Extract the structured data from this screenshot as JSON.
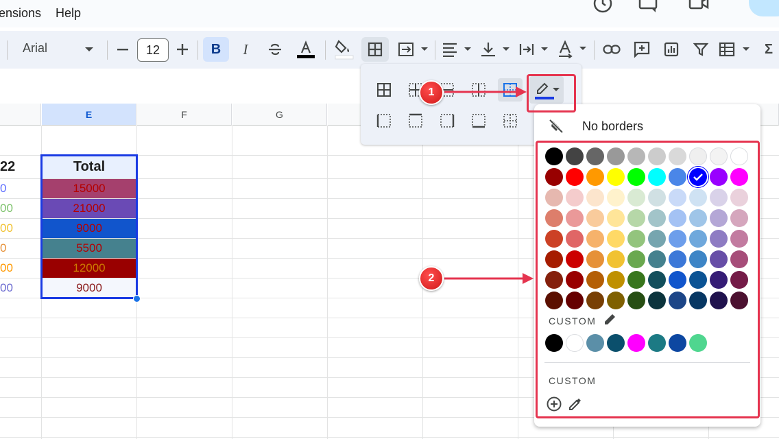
{
  "menubar": {
    "items": [
      "ensions",
      "Help"
    ]
  },
  "toolbar": {
    "font_name": "Arial",
    "font_size": "12",
    "bold_label": "B",
    "italic_label": "I",
    "text_color_underline": "#000000",
    "sum_label": "Σ"
  },
  "grid": {
    "columns": [
      {
        "label": "E",
        "selected": true
      },
      {
        "label": "F",
        "selected": false
      },
      {
        "label": "G",
        "selected": false
      }
    ],
    "header_row": {
      "partial_left": "22",
      "total_label": "Total"
    },
    "rows": [
      {
        "left": "0",
        "left_color": "#5b6cff",
        "value": "15000",
        "bg": "#a5406d",
        "fg": "#b40000"
      },
      {
        "left": "00",
        "left_color": "#7cc26b",
        "value": "21000",
        "bg": "#6a4ab5",
        "fg": "#b40000"
      },
      {
        "left": "00",
        "left_color": "#f1c232",
        "value": "9000",
        "bg": "#1155cc",
        "fg": "#b40000"
      },
      {
        "left": "0",
        "left_color": "#e69138",
        "value": "5500",
        "bg": "#45818e",
        "fg": "#b40000"
      },
      {
        "left": "00",
        "left_color": "#ff9900",
        "value": "12000",
        "bg": "#990000",
        "fg": "#cc7a00"
      },
      {
        "left": "00",
        "left_color": "#6d6dd1",
        "value": "9000",
        "bg": "#f4f7fd",
        "fg": "#8b1c1c"
      }
    ]
  },
  "borders_menu": {
    "line_color_indicator": "#1a3be3"
  },
  "color_popup": {
    "no_borders_label": "No borders",
    "custom_label_1": "CUSTOM",
    "custom_label_2": "CUSTOM",
    "selected_color": "#0000ff",
    "palette_rows": [
      [
        "#000000",
        "#434343",
        "#666666",
        "#999999",
        "#b7b7b7",
        "#cccccc",
        "#d9d9d9",
        "#efefef",
        "#f3f3f3",
        "#ffffff"
      ],
      [
        "#980000",
        "#ff0000",
        "#ff9900",
        "#ffff00",
        "#00ff00",
        "#00ffff",
        "#4a86e8",
        "#0000ff",
        "#9900ff",
        "#ff00ff"
      ],
      [
        "#e6b8af",
        "#f4cccc",
        "#fce5cd",
        "#fff2cc",
        "#d9ead3",
        "#d0e0e3",
        "#c9daf8",
        "#cfe2f3",
        "#d9d2e9",
        "#ead1dc"
      ],
      [
        "#dd7e6b",
        "#ea9999",
        "#f9cb9c",
        "#ffe599",
        "#b6d7a8",
        "#a2c4c9",
        "#a4c2f4",
        "#9fc5e8",
        "#b4a7d6",
        "#d5a6bd"
      ],
      [
        "#cc4125",
        "#e06666",
        "#f6b26b",
        "#ffd966",
        "#93c47d",
        "#76a5af",
        "#6d9eeb",
        "#6fa8dc",
        "#8e7cc3",
        "#c27ba0"
      ],
      [
        "#a61c00",
        "#cc0000",
        "#e69138",
        "#f1c232",
        "#6aa84f",
        "#45818e",
        "#3c78d8",
        "#3d85c6",
        "#674ea7",
        "#a64d79"
      ],
      [
        "#85200c",
        "#990000",
        "#b45f06",
        "#bf9000",
        "#38761d",
        "#134f5c",
        "#1155cc",
        "#0b5394",
        "#351c75",
        "#741b47"
      ],
      [
        "#5b0f00",
        "#660000",
        "#783f04",
        "#7f6000",
        "#274e13",
        "#0c343d",
        "#1c4587",
        "#073763",
        "#20124d",
        "#4c1130"
      ]
    ],
    "custom_colors": [
      "#000000",
      "#ffffff",
      "#5b8fa8",
      "#0b4f6c",
      "#ff00ff",
      "#1c7a84",
      "#0d47a1",
      "#4fd68f"
    ]
  },
  "annotations": {
    "badge_1": "1",
    "badge_2": "2",
    "color": "#e5344f"
  }
}
